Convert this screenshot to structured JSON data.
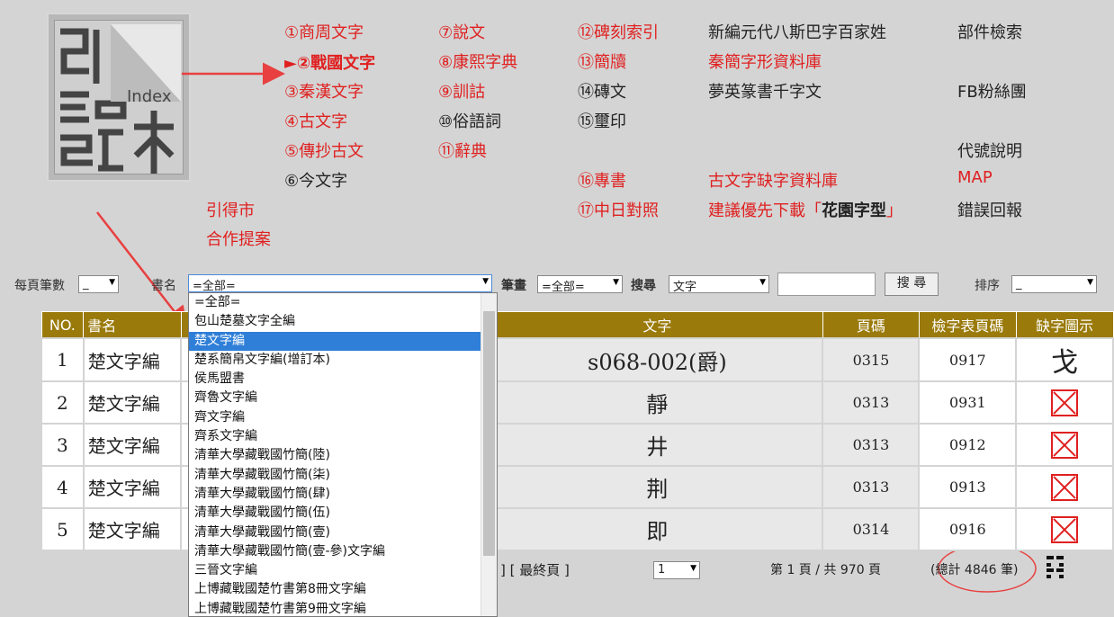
{
  "logo": {
    "text": "Index"
  },
  "nav": {
    "c1": [
      "①商周文字",
      "►②戰國文字",
      "③秦漢文字",
      "④古文字",
      "⑤傳抄古文",
      "⑥今文字"
    ],
    "c2": [
      "⑦說文",
      "⑧康熙字典",
      "⑨訓詁",
      "⑩俗語詞",
      "⑪辭典"
    ],
    "c3": [
      "⑫碑刻索引",
      "⑬簡牘",
      "⑭磚文",
      "⑮璽印",
      "⑯專書",
      "⑰中日對照"
    ],
    "c4": [
      "新編元代八斯巴字百家姓",
      "秦簡字形資料庫",
      "夢英篆書千字文",
      "古文字缺字資料庫",
      "建議優先下載「",
      "花園字型",
      "」"
    ],
    "c5": [
      "部件檢索",
      "FB粉絲團",
      "代號說明",
      "MAP",
      "錯誤回報"
    ],
    "left": [
      "引得市",
      "合作提案"
    ]
  },
  "search": {
    "per_page_label": "每頁筆數",
    "per_page_value": "_",
    "book_label": "書名",
    "book_value": "=全部=",
    "stroke_label": "筆畫",
    "stroke_value": "=全部=",
    "search_label": "搜尋",
    "search_type": "文字",
    "search_input": "",
    "search_button": "搜 尋",
    "sort_label": "排序",
    "sort_value": "_"
  },
  "table": {
    "headers": [
      "NO.",
      "書名",
      "文字",
      "頁碼",
      "檢字表頁碼",
      "缺字圖示"
    ],
    "rows": [
      {
        "no": "1",
        "book": "楚文字編",
        "char": "s068-002(爵)",
        "page": "0315",
        "index_page": "0917",
        "img": "glyph"
      },
      {
        "no": "2",
        "book": "楚文字編",
        "char": "靜",
        "page": "0313",
        "index_page": "0931",
        "img": "missing"
      },
      {
        "no": "3",
        "book": "楚文字編",
        "char": "井",
        "page": "0313",
        "index_page": "0912",
        "img": "missing"
      },
      {
        "no": "4",
        "book": "楚文字編",
        "char": "荆",
        "page": "0313",
        "index_page": "0913",
        "img": "missing"
      },
      {
        "no": "5",
        "book": "楚文字編",
        "char": "即",
        "page": "0314",
        "index_page": "0916",
        "img": "missing"
      }
    ],
    "glyph_char": "戈"
  },
  "dropdown": {
    "items": [
      "=全部=",
      "包山楚墓文字全編",
      "楚文字編",
      "楚系簡帛文字編(增訂本)",
      "侯馬盟書",
      "齊魯文字編",
      "齊文字編",
      "齊系文字編",
      "清華大學藏戰國竹簡(陸)",
      "清華大學藏戰國竹簡(柒)",
      "清華大學藏戰國竹簡(肆)",
      "清華大學藏戰國竹簡(伍)",
      "清華大學藏戰國竹簡(壹)",
      "清華大學藏戰國竹簡(壹-參)文字編",
      "三晉文字編",
      "上博藏戰國楚竹書第8冊文字編",
      "上博藏戰國楚竹書第9冊文字編"
    ],
    "highlight_index": 2
  },
  "pager": {
    "last_page": "] [ 最終頁 ]",
    "page_select": "1",
    "status": "第 1 頁 / 共 970 頁",
    "total": "(總計 4846 筆)"
  },
  "colors": {
    "accent_red": "#e02020",
    "header_gold": "#9a7a0a",
    "highlight_blue": "#2f7fd8"
  }
}
